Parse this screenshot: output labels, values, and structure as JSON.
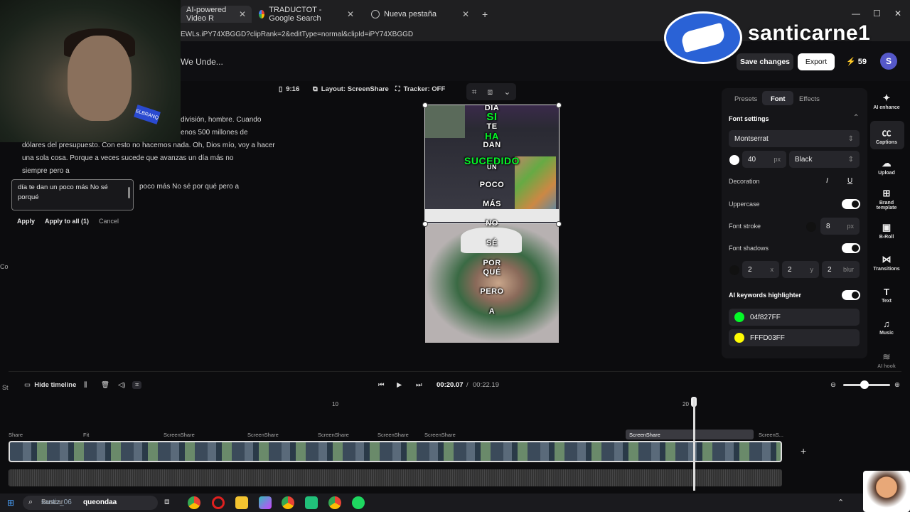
{
  "browser": {
    "tabs": [
      {
        "label": "AI-powered Video R",
        "active": true
      },
      {
        "label": "TRADUCTOT - Google Search",
        "active": false
      },
      {
        "label": "Nueva pestaña",
        "active": false
      }
    ],
    "url": "EWLs.iPY74XBGGD?clipRank=2&editType=normal&clipId=iPY74XBGGD",
    "window_controls": [
      "—",
      "☐",
      "✕"
    ]
  },
  "overlay": {
    "streamer_name": "santicarne1",
    "sticker_text": "ELBRANQ"
  },
  "header": {
    "project_title": "We Unde...",
    "save_label": "Save changes",
    "export_label": "Export",
    "credits": "59",
    "avatar_letter": "S"
  },
  "transcript": {
    "lines": [
      "división, hombre. Cuando",
      "enos 500 millones de",
      "dólares del presupuesto. Con esto no hacemos nada. Oh, Dios mío, voy a hacer",
      "una sola cosa. Porque a veces sucede que avanzas un día más no",
      "siempre pero a",
      "poco más No sé por qué pero a"
    ],
    "edit_text": "día te dan un poco más No sé porqué",
    "apply_label": "Apply",
    "apply_all_label": "Apply to all (1)",
    "cancel_label": "Cancel",
    "side_labels": [
      "Co",
      "St"
    ]
  },
  "toolbar": {
    "aspect": "9:16",
    "layout": "Layout: ScreenShare",
    "tracker": "Tracker: OFF"
  },
  "preview": {
    "caption_words": [
      "DÍA",
      "SI",
      "TE",
      "HA",
      "DAN",
      "SUCEDIDO",
      "UN",
      "POCO",
      "MÁS",
      "NO",
      "SÉ",
      "POR",
      "QUÉ",
      "PERO",
      "A"
    ],
    "highlight_green": "#04F827",
    "highlight_yellow": "#FFFD03"
  },
  "panel": {
    "tabs": [
      "Presets",
      "Font",
      "Effects"
    ],
    "active_tab": "Font",
    "font_settings_label": "Font settings",
    "font_family": "Montserrat",
    "font_size": "40",
    "font_size_unit": "px",
    "font_weight": "Black",
    "decoration_label": "Decoration",
    "uppercase_label": "Uppercase",
    "font_stroke_label": "Font stroke",
    "stroke_value": "8",
    "stroke_unit": "px",
    "font_shadows_label": "Font shadows",
    "shadow_x": "2",
    "shadow_x_unit": "x",
    "shadow_y": "2",
    "shadow_y_unit": "y",
    "shadow_blur": "2",
    "shadow_blur_unit": "blur",
    "keywords_label": "AI keywords highlighter",
    "color1": "04f827FF",
    "color2": "FFFD03FF"
  },
  "sidenav": [
    {
      "label": "AI enhance",
      "icon": "sparkle-icon"
    },
    {
      "label": "Captions",
      "icon": "cc-icon"
    },
    {
      "label": "Upload",
      "icon": "upload-icon"
    },
    {
      "label": "Brand template",
      "icon": "grid-icon"
    },
    {
      "label": "B-Roll",
      "icon": "image-icon"
    },
    {
      "label": "Transitions",
      "icon": "transitions-icon"
    },
    {
      "label": "Text",
      "icon": "text-icon"
    },
    {
      "label": "Music",
      "icon": "music-icon"
    },
    {
      "label": "AI hook",
      "icon": "waveform-icon"
    }
  ],
  "timeline": {
    "hide_label": "Hide timeline",
    "current_time": "00:20.07",
    "separator": "/",
    "total_time": "00:22.19",
    "ruler_marks": [
      "10",
      "20"
    ],
    "segments": [
      "Share",
      "Fit",
      "ScreenShare",
      "ScreenShare",
      "ScreenShare",
      "ScreenShare",
      "ScreenShare",
      "ScreenShare",
      "ScreenS..."
    ]
  },
  "taskbar": {
    "search_placeholder": "Buscar",
    "user_tag": "santiz_06",
    "query_text": "queondaa"
  }
}
